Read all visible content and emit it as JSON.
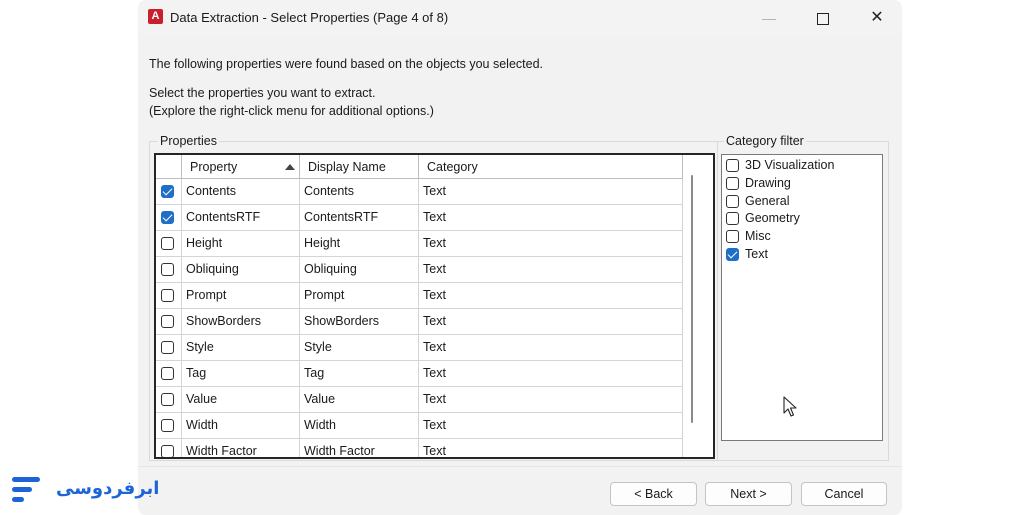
{
  "window": {
    "title": "Data Extraction - Select Properties (Page 4 of 8)",
    "app_icon_letter": "A",
    "minimize_glyph": "—",
    "close_glyph": "✕"
  },
  "instructions": {
    "line1": "The following properties were found based on the objects you selected.",
    "line2": "Select the properties you want to extract.",
    "line3": "(Explore the right-click menu for additional options.)"
  },
  "properties": {
    "group_label": "Properties",
    "columns": {
      "property": "Property",
      "display_name": "Display Name",
      "category": "Category"
    },
    "sort": {
      "column": "property",
      "direction": "ascending"
    },
    "rows": [
      {
        "checked": true,
        "property": "Contents",
        "display_name": "Contents",
        "category": "Text"
      },
      {
        "checked": true,
        "property": "ContentsRTF",
        "display_name": "ContentsRTF",
        "category": "Text"
      },
      {
        "checked": false,
        "property": "Height",
        "display_name": "Height",
        "category": "Text"
      },
      {
        "checked": false,
        "property": "Obliquing",
        "display_name": "Obliquing",
        "category": "Text"
      },
      {
        "checked": false,
        "property": "Prompt",
        "display_name": "Prompt",
        "category": "Text"
      },
      {
        "checked": false,
        "property": "ShowBorders",
        "display_name": "ShowBorders",
        "category": "Text"
      },
      {
        "checked": false,
        "property": "Style",
        "display_name": "Style",
        "category": "Text"
      },
      {
        "checked": false,
        "property": "Tag",
        "display_name": "Tag",
        "category": "Text"
      },
      {
        "checked": false,
        "property": "Value",
        "display_name": "Value",
        "category": "Text"
      },
      {
        "checked": false,
        "property": "Width",
        "display_name": "Width",
        "category": "Text"
      },
      {
        "checked": false,
        "property": "Width Factor",
        "display_name": "Width Factor",
        "category": "Text"
      }
    ]
  },
  "category_filter": {
    "group_label": "Category filter",
    "items": [
      {
        "label": "3D Visualization",
        "checked": false
      },
      {
        "label": "Drawing",
        "checked": false
      },
      {
        "label": "General",
        "checked": false
      },
      {
        "label": "Geometry",
        "checked": false
      },
      {
        "label": "Misc",
        "checked": false
      },
      {
        "label": "Text",
        "checked": true
      }
    ]
  },
  "buttons": {
    "back": "< Back",
    "next": "Next >",
    "cancel": "Cancel"
  },
  "watermark": {
    "text": "ابرفردوسی"
  },
  "colors": {
    "accent": "#1f6fc6",
    "app_icon": "#c8202f",
    "watermark": "#1d64d8"
  }
}
